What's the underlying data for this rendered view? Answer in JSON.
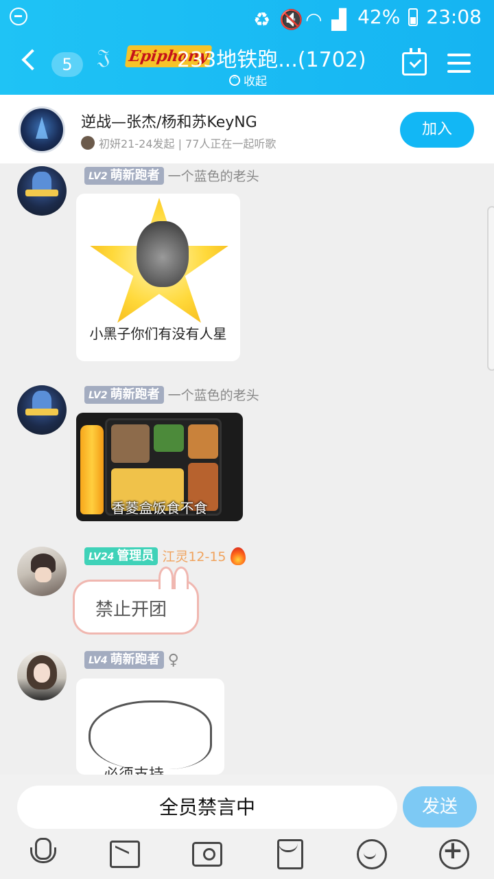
{
  "status": {
    "battery_percent": "42%",
    "time": "23:08"
  },
  "header": {
    "unread_count": "5",
    "group_logo": "Epiphany",
    "group_name": "233地铁跑...(1702)",
    "collapse_label": "收起",
    "icons": [
      "back-icon",
      "ear-icon",
      "calendar-check-icon",
      "menu-icon"
    ]
  },
  "listen_banner": {
    "song": "逆战—张杰/杨和苏KeyNG",
    "meta": "初妍21-24发起 | 77人正在一起听歌",
    "join_label": "加入"
  },
  "messages": [
    {
      "level": "LV2",
      "title": "萌新跑者",
      "nickname": "一个蓝色的老头",
      "sticker_caption": "小黑子你们有没有人星"
    },
    {
      "level": "LV2",
      "title": "萌新跑者",
      "nickname": "一个蓝色的老头",
      "sticker_caption": "香菱盒饭食不食"
    },
    {
      "level": "LV24",
      "title": "管理员",
      "nickname": "江灵12-15",
      "text": "禁止开团"
    },
    {
      "level": "LV4",
      "title": "萌新跑者",
      "gender": "♀",
      "sticker_caption": "必须支持"
    }
  ],
  "composer": {
    "placeholder": "全员禁言中",
    "send_label": "发送",
    "tools": [
      "microphone-icon",
      "image-icon",
      "camera-icon",
      "red-packet-icon",
      "emoji-icon",
      "plus-icon"
    ]
  },
  "colors": {
    "header_bg": "#15b4f2",
    "join_button": "#12b7f5",
    "send_button": "#7dc9f4",
    "level_gray": "#a3acc0",
    "level_green": "#3fd2b8",
    "admin_name": "#f0a25c"
  }
}
